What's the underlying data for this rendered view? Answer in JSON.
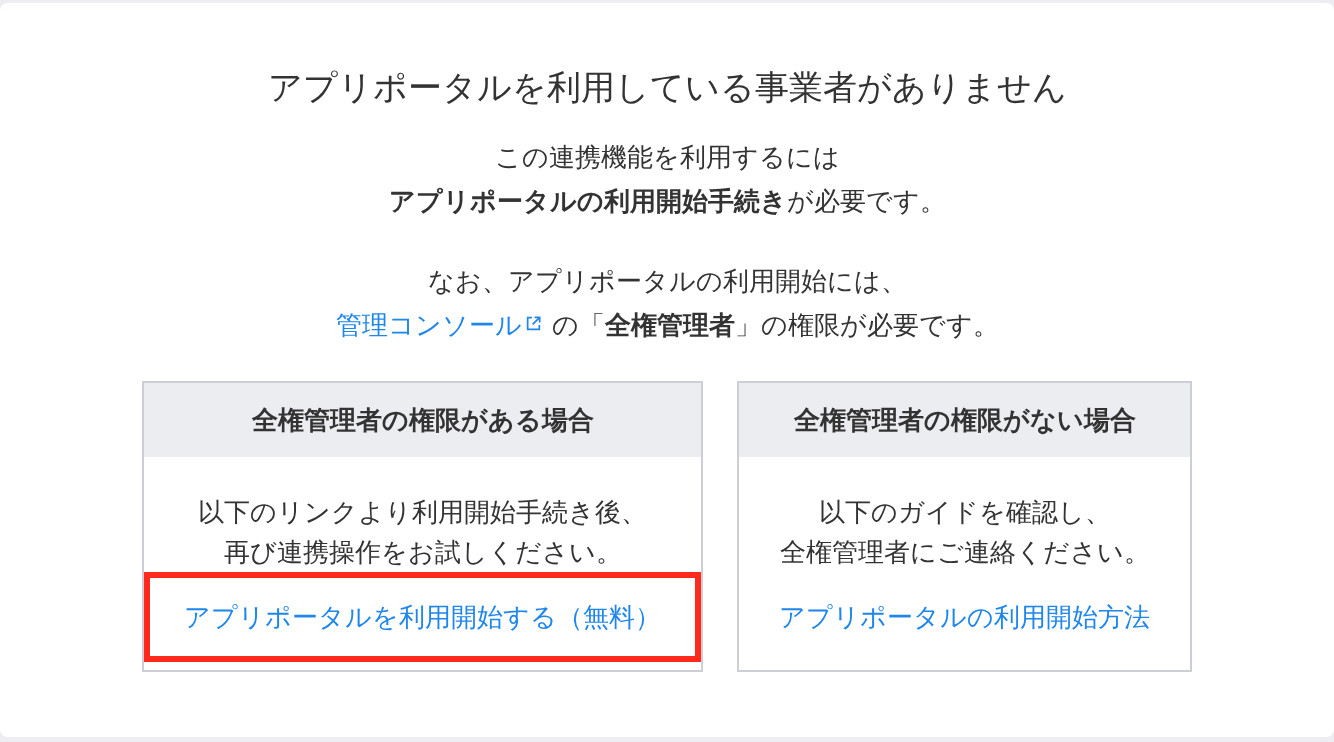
{
  "title": "アプリポータルを利用している事業者がありません",
  "intro": {
    "lines": [
      "この連携機能を利用するには",
      "**アプリポータルの利用開始手続き**が必要です。"
    ]
  },
  "note": {
    "text_before": "なお、アプリポータルの利用開始には、",
    "link": {
      "label": "管理コンソール",
      "external": true
    },
    "text_after": "の「**全権管理者**」の権限が必要です。"
  },
  "cards": [
    {
      "heading": "全権管理者の権限がある場合",
      "lines": [
        "以下のリンクより利用開始手続き後、",
        "再び連携操作をお試しください。"
      ],
      "link": {
        "label": "アプリポータルを利用開始する（無料）",
        "highlighted": true
      }
    },
    {
      "heading": "全権管理者の権限がない場合",
      "lines": [
        "以下のガイドを確認し、",
        "全権管理者にご連絡ください。"
      ],
      "link": {
        "label": "アプリポータルの利用開始方法",
        "highlighted": false
      }
    }
  ]
}
